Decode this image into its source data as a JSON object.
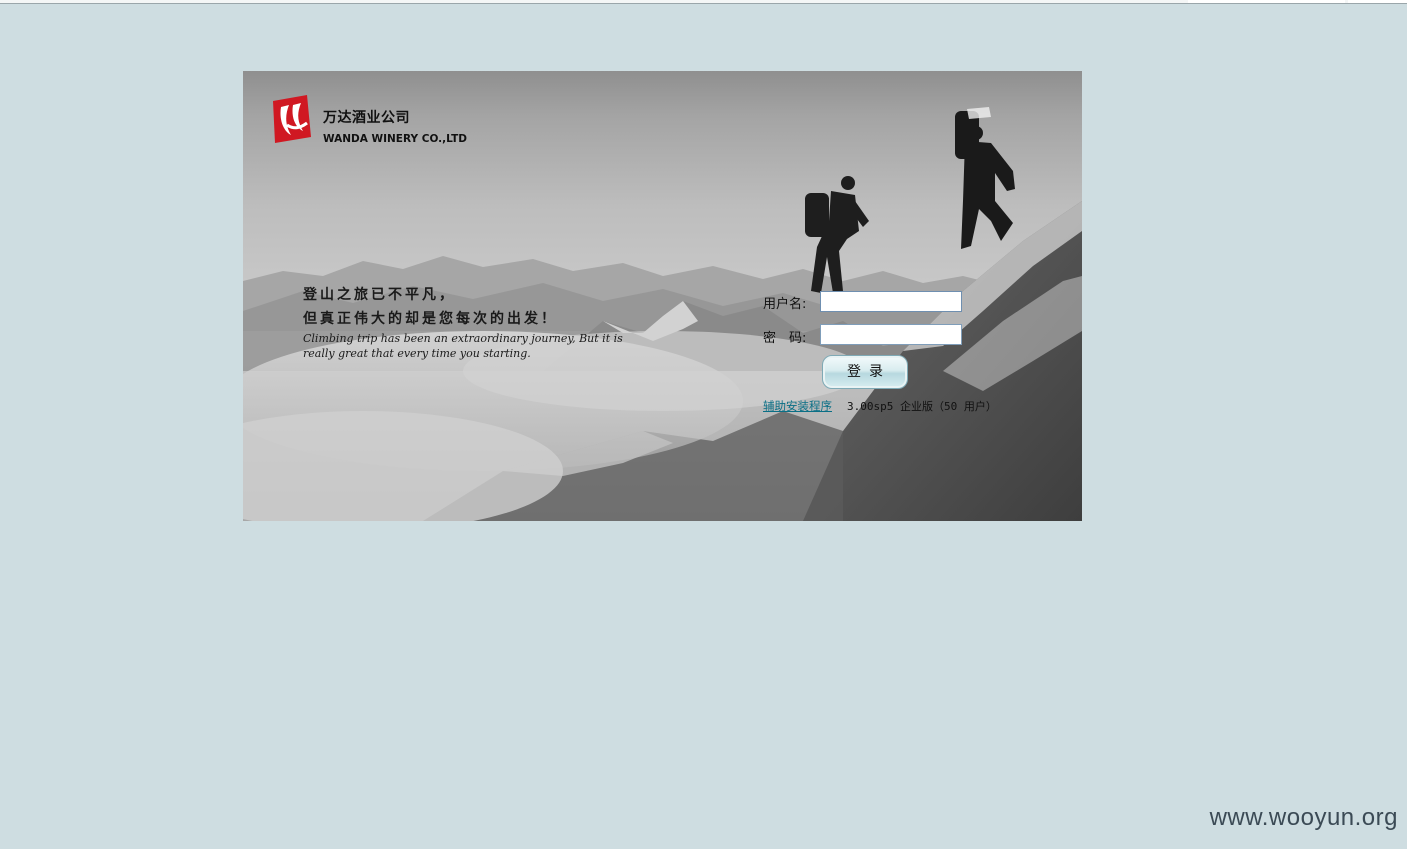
{
  "company": {
    "name_cn": "万达酒业公司",
    "name_en": "WANDA WINERY CO.,LTD",
    "logo_icon": "wanda-logo-icon"
  },
  "slogan": {
    "line1": "登山之旅已不平凡，",
    "line2": "但真正伟大的却是您每次的出发！",
    "english": "Climbing trip has been an extraordinary journey, But it is really great that every time you starting."
  },
  "login": {
    "username_label": "用户名:",
    "password_label": "密　码:",
    "username_value": "",
    "password_value": "",
    "submit_label": "登录",
    "help_link": "辅助安装程序",
    "version": "3.00sp5 企业版（50 用户）"
  },
  "watermark": "www.wooyun.org",
  "colors": {
    "page_bg": "#cedde1",
    "link": "#0a6f86",
    "logo_red": "#d01822"
  }
}
